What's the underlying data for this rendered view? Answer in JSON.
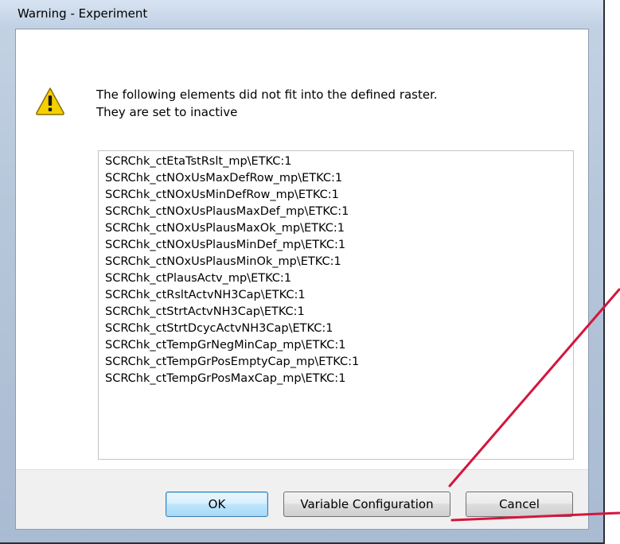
{
  "window": {
    "title": "Warning - Experiment"
  },
  "message": {
    "line1": "The following elements did not fit into the defined raster.",
    "line2": "They are set to inactive",
    "icon": "warning-icon"
  },
  "elements": [
    "SCRChk_ctEtaTstRslt_mp\\ETKC:1",
    "SCRChk_ctNOxUsMaxDefRow_mp\\ETKC:1",
    "SCRChk_ctNOxUsMinDefRow_mp\\ETKC:1",
    "SCRChk_ctNOxUsPlausMaxDef_mp\\ETKC:1",
    "SCRChk_ctNOxUsPlausMaxOk_mp\\ETKC:1",
    "SCRChk_ctNOxUsPlausMinDef_mp\\ETKC:1",
    "SCRChk_ctNOxUsPlausMinOk_mp\\ETKC:1",
    "SCRChk_ctPlausActv_mp\\ETKC:1",
    "SCRChk_ctRsltActvNH3Cap\\ETKC:1",
    "SCRChk_ctStrtActvNH3Cap\\ETKC:1",
    "SCRChk_ctStrtDcycActvNH3Cap\\ETKC:1",
    "SCRChk_ctTempGrNegMinCap_mp\\ETKC:1",
    "SCRChk_ctTempGrPosEmptyCap_mp\\ETKC:1",
    "SCRChk_ctTempGrPosMaxCap_mp\\ETKC:1"
  ],
  "buttons": {
    "ok": "OK",
    "variable_configuration": "Variable Configuration",
    "cancel": "Cancel"
  },
  "colors": {
    "annotation_arrow": "#d4163c",
    "warning_yellow": "#f5d000"
  }
}
